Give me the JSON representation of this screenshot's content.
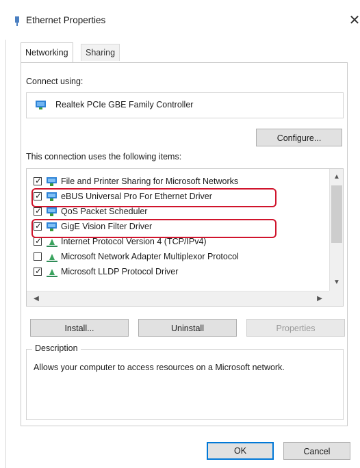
{
  "window": {
    "title": "Ethernet Properties"
  },
  "tabs": [
    {
      "label": "Networking"
    },
    {
      "label": "Sharing"
    }
  ],
  "connect_using_label": "Connect using:",
  "adapter_name": "Realtek PCIe GBE Family Controller",
  "configure_label": "Configure...",
  "items_label": "This connection uses the following items:",
  "items": [
    {
      "label": "File and Printer Sharing for Microsoft Networks",
      "checked": true,
      "icon": "network-service-icon"
    },
    {
      "label": "eBUS Universal Pro For Ethernet Driver",
      "checked": true,
      "icon": "network-service-icon"
    },
    {
      "label": "QoS Packet Scheduler",
      "checked": true,
      "icon": "network-service-icon"
    },
    {
      "label": "GigE Vision Filter Driver",
      "checked": true,
      "icon": "network-service-icon"
    },
    {
      "label": "Internet Protocol Version 4 (TCP/IPv4)",
      "checked": true,
      "icon": "protocol-icon"
    },
    {
      "label": "Microsoft Network Adapter Multiplexor Protocol",
      "checked": false,
      "icon": "protocol-icon"
    },
    {
      "label": "Microsoft LLDP Protocol Driver",
      "checked": true,
      "icon": "protocol-icon"
    }
  ],
  "buttons": {
    "install": "Install...",
    "uninstall": "Uninstall",
    "properties": "Properties",
    "ok": "OK",
    "cancel": "Cancel"
  },
  "description": {
    "title": "Description",
    "text": "Allows your computer to access resources on a Microsoft network."
  },
  "colors": {
    "highlight": "#d0142c",
    "accent": "#0078d7"
  }
}
